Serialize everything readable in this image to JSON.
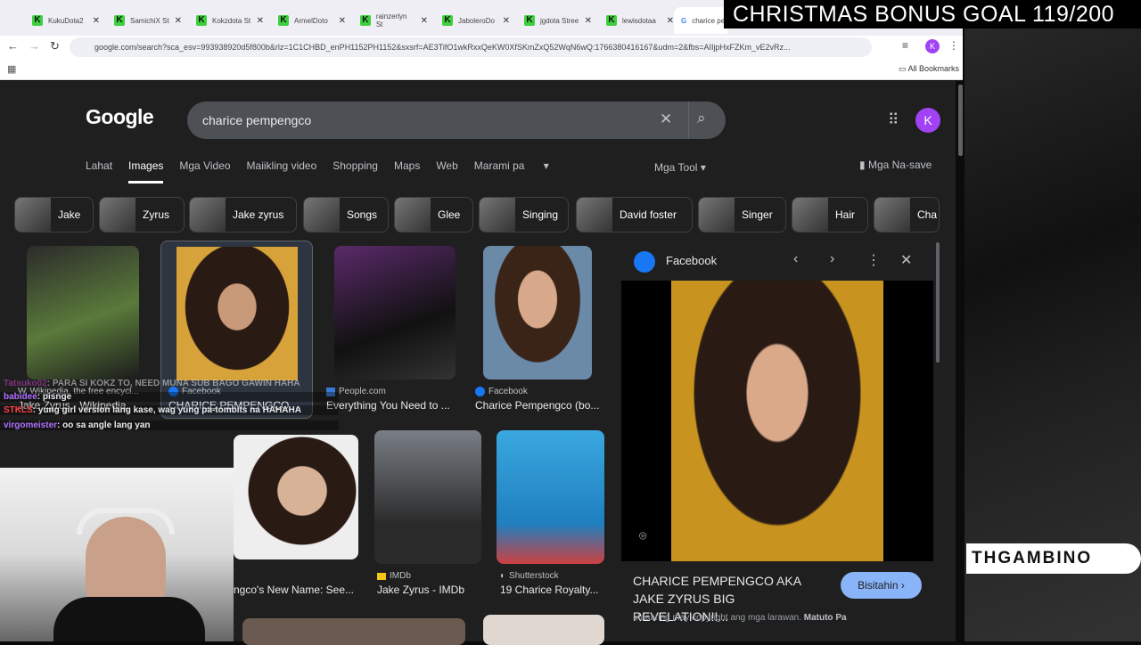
{
  "overlay": {
    "goal_text": "CHRISTMAS BONUS GOAL 119/200",
    "banner_text": "THGAMBINO"
  },
  "browser": {
    "tabs": [
      "KukuDota2",
      "SamichiX St",
      "Kokzdota St",
      "ArmelDoto",
      "rainzerlyn St",
      "JaboleroDo",
      "jgdota Stree",
      "lewisdotaa",
      "charice pe"
    ],
    "url": "google.com/search?sca_esv=993938920d5f800b&rlz=1C1CHBD_enPH1152PH1152&sxsrf=AE3TifO1wkRxxQeKW0XfSKmZxQ52WqN6wQ:1766380416167&udm=2&fbs=AIIjpHxFZKm_vE2vRz...",
    "bookmarks_label": "All Bookmarks",
    "profile_initial": "K"
  },
  "search": {
    "logo": "Google",
    "query": "charice pempengco",
    "profile_initial": "K"
  },
  "nav": {
    "tabs": [
      "Lahat",
      "Images",
      "Mga Video",
      "Maiikling video",
      "Shopping",
      "Maps",
      "Web",
      "Marami pa"
    ],
    "tools": "Mga Tool",
    "saved": "Mga Na-save"
  },
  "chips": [
    "Jake",
    "Zyrus",
    "Jake zyrus",
    "Songs",
    "Glee",
    "Singing",
    "David foster",
    "Singer",
    "Hair",
    "Cha"
  ],
  "results": [
    {
      "source": "Wikipedia, the free encycl...",
      "title": "Jake Zyrus - Wikipedia"
    },
    {
      "source": "Facebook",
      "title": "CHARICE PEMPENGCO ..."
    },
    {
      "source": "People.com",
      "title": "Everything You Need to ..."
    },
    {
      "source": "Facebook",
      "title": "Charice Pempengco (bo..."
    },
    {
      "source": "",
      "title": "ngco's New Name: See..."
    },
    {
      "source": "IMDb",
      "title": "Jake Zyrus - IMDb"
    },
    {
      "source": "Shutterstock",
      "title": "19 Charice Royalty..."
    }
  ],
  "preview": {
    "source": "Facebook",
    "title": "CHARICE PEMPENGCO AKA JAKE ZYRUS BIG REVELATION!!...",
    "visit": "Bisitahin",
    "copyright": "Maaaring may copyright ang mga larawan.",
    "learn_more": "Matuto Pa"
  },
  "chat": [
    {
      "user": "Tatsuko02",
      "msg": ": PARA SI KOKZ TO, NEED MUNA SUB BAGO GAWIN HAHA",
      "color": "#c040c0"
    },
    {
      "user": "babidee",
      "msg": ": pisnge",
      "color": "#b070ff"
    },
    {
      "user": "STKLS",
      "msg": ": yung girl version lang kase, wag yung pa-tombits na HAHAHA",
      "color": "#ff4040"
    },
    {
      "user": "virgomeister",
      "msg": ": oo sa angle lang yan",
      "color": "#b070ff"
    }
  ],
  "colors": {
    "page_bg": "#1f1f1f",
    "accent": "#8ab4f8",
    "profile": "#a142f4"
  }
}
